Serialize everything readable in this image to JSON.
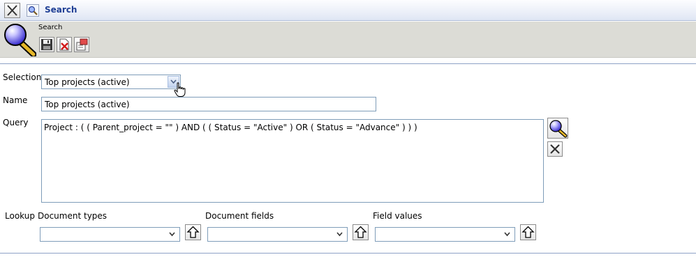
{
  "window": {
    "title": "Search",
    "close_icon": "close-icon",
    "title_icon": "search-icon"
  },
  "toolbar": {
    "label": "Search",
    "buttons": [
      {
        "name": "save",
        "icon": "save-icon"
      },
      {
        "name": "delete",
        "icon": "delete-icon"
      },
      {
        "name": "properties",
        "icon": "properties-icon"
      }
    ]
  },
  "form": {
    "selection_label": "Selection",
    "selection_value": "Top projects (active)",
    "name_label": "Name",
    "name_value": "Top projects (active)",
    "query_label": "Query",
    "query_value": "Project : ( ( Parent_project = \"\" ) AND ( ( Status = \"Active\" ) OR ( Status = \"Advance\" ) ) )",
    "run_search_icon": "search-icon",
    "clear_query_icon": "close-icon"
  },
  "lookup": {
    "label": "Lookup",
    "document_types_label": "Document types",
    "document_types_value": "",
    "document_fields_label": "Document fields",
    "document_fields_value": "",
    "field_values_label": "Field values",
    "field_values_value": "",
    "insert_icon": "arrow-up-icon"
  },
  "colors": {
    "title_text": "#1f3f95",
    "toolbar_bg": "#dcdcd6",
    "field_border": "#7f9db9",
    "divider": "#8ea2c6"
  }
}
